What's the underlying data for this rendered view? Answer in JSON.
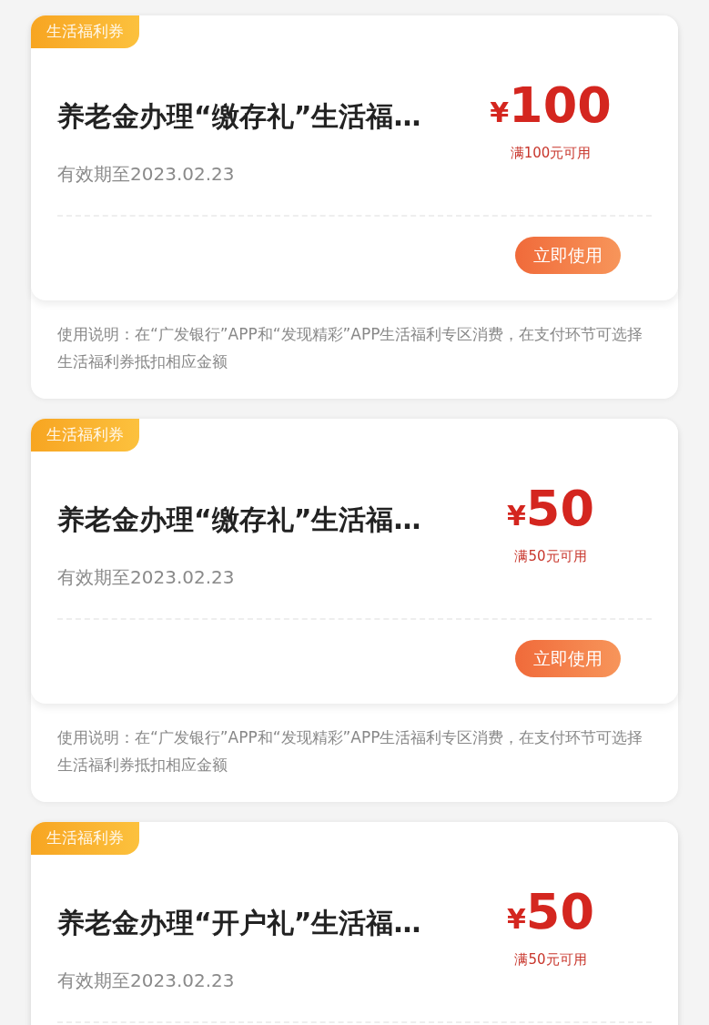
{
  "coupons": [
    {
      "tag": "生活福利券",
      "title": "养老金办理“缴存礼”生活福…",
      "currency": "¥",
      "amount": "100",
      "condition": "满100元可用",
      "validity": "有效期至2023.02.23",
      "button": "立即使用",
      "notes": "使用说明：在“广发银行”APP和“发现精彩”APP生活福利专区消费，在支付环节可选择生活福利券抵扣相应金额"
    },
    {
      "tag": "生活福利券",
      "title": "养老金办理“缴存礼”生活福…",
      "currency": "¥",
      "amount": "50",
      "condition": "满50元可用",
      "validity": "有效期至2023.02.23",
      "button": "立即使用",
      "notes": "使用说明：在“广发银行”APP和“发现精彩”APP生活福利专区消费，在支付环节可选择生活福利券抵扣相应金额"
    },
    {
      "tag": "生活福利券",
      "title": "养老金办理“开户礼”生活福…",
      "currency": "¥",
      "amount": "50",
      "condition": "满50元可用",
      "validity": "有效期至2023.02.23"
    }
  ]
}
